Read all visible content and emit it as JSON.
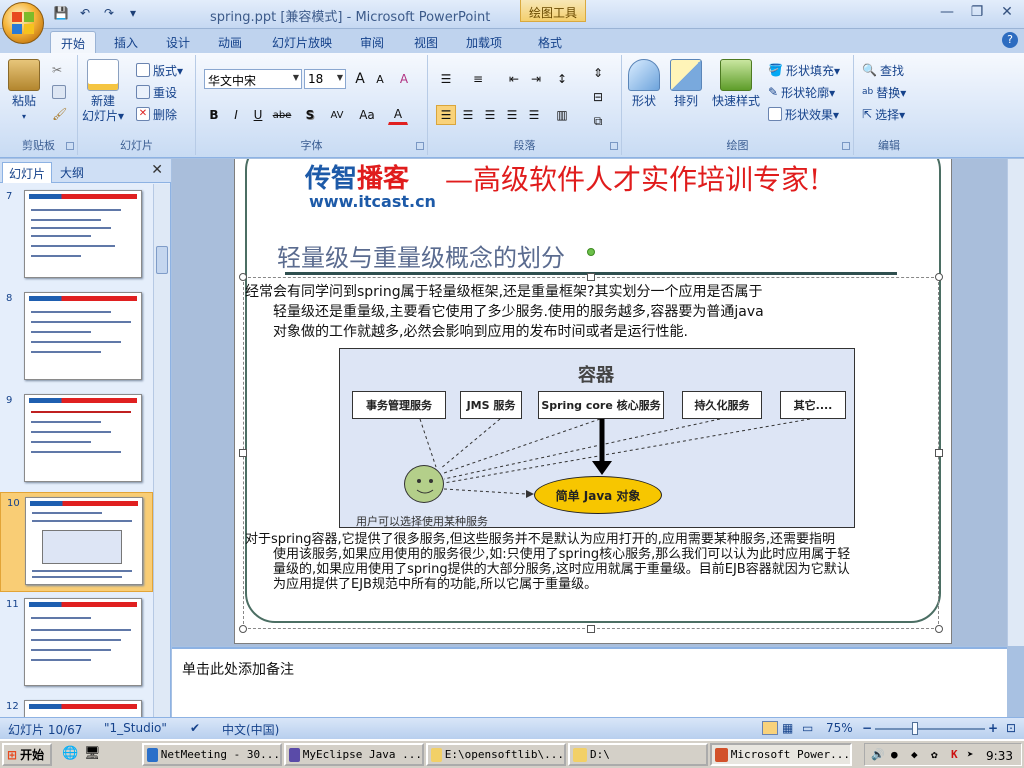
{
  "window": {
    "title": "spring.ppt [兼容模式] - Microsoft PowerPoint",
    "contextual_tab_group": "绘图工具"
  },
  "qat": {
    "save": "💾",
    "undo": "↶",
    "redo": "↷",
    "more": "▾"
  },
  "window_controls": {
    "minimize": "—",
    "restore": "❐",
    "close": "✕"
  },
  "tabs": [
    "开始",
    "插入",
    "设计",
    "动画",
    "幻灯片放映",
    "审阅",
    "视图",
    "加载项",
    "格式"
  ],
  "active_tab": "开始",
  "help": "?",
  "ribbon": {
    "clipboard": {
      "label": "剪贴板",
      "paste": "粘贴"
    },
    "slides": {
      "label": "幻灯片",
      "new_slide_1": "新建",
      "new_slide_2": "幻灯片▾",
      "layout": "版式▾",
      "reset": "重设",
      "delete": "删除"
    },
    "font": {
      "label": "字体",
      "font_name": "华文中宋",
      "font_size": "18",
      "grow": "A",
      "shrink": "A",
      "clear": "A",
      "bold": "B",
      "italic": "I",
      "underline": "U",
      "strike": "abe",
      "shadow": "S",
      "spacing": "AV",
      "case": "Aa",
      "color": "A"
    },
    "paragraph": {
      "label": "段落"
    },
    "drawing": {
      "label": "绘图",
      "shapes": "形状",
      "arrange": "排列",
      "quick_styles": "快速样式",
      "fill": "形状填充▾",
      "outline": "形状轮廓▾",
      "effects": "形状效果▾"
    },
    "editing": {
      "label": "编辑",
      "find": "查找",
      "replace": "替换▾",
      "select": "选择▾"
    }
  },
  "panel": {
    "tabs": [
      "幻灯片",
      "大纲"
    ],
    "close": "✕",
    "thumbnails": [
      {
        "num": "7",
        "selected": false
      },
      {
        "num": "8",
        "selected": false
      },
      {
        "num": "9",
        "selected": false
      },
      {
        "num": "10",
        "selected": true
      },
      {
        "num": "11",
        "selected": false
      },
      {
        "num": "12",
        "selected": false
      }
    ]
  },
  "slide": {
    "logo_cn_a": "传智",
    "logo_cn_b": "播客",
    "logo_url": "www.itcast.cn",
    "slogan": "—高级软件人才实作培训专家!",
    "title": "轻量级与重量级概念的划分",
    "para1": [
      "经常会有同学问到spring属于轻量级框架,还是重量框架?其实划分一个应用是否属于",
      "轻量级还是重量级,主要看它使用了多少服务.使用的服务越多,容器要为普通java",
      "对象做的工作就越多,必然会影响到应用的发布时间或者是运行性能."
    ],
    "diagram": {
      "title": "容器",
      "services": [
        "事务管理服务",
        "JMS 服务",
        "Spring core 核心服务",
        "持久化服务",
        "其它...."
      ],
      "core_object": "简单 Java 对象",
      "user_caption": "用户可以选择使用某种服务"
    },
    "para2": [
      "对于spring容器,它提供了很多服务,但这些服务并不是默认为应用打开的,应用需要某种服务,还需要指明",
      "使用该服务,如果应用使用的服务很少,如:只使用了spring核心服务,那么我们可以认为此时应用属于轻",
      "量级的,如果应用使用了spring提供的大部分服务,这时应用就属于重量级。目前EJB容器就因为它默认",
      "为应用提供了EJB规范中所有的功能,所以它属于重量级。"
    ]
  },
  "notes": {
    "placeholder": "单击此处添加备注"
  },
  "status": {
    "slide_counter": "幻灯片 10/67",
    "theme": "\"1_Studio\"",
    "language": "中文(中国)",
    "zoom": "75%",
    "zoom_minus": "−",
    "zoom_plus": "+"
  },
  "taskbar": {
    "start": "开始",
    "tasks": [
      "NetMeeting - 30...",
      "MyEclipse Java ...",
      "E:\\opensoftlib\\...",
      "D:\\",
      "Microsoft Power..."
    ],
    "active_task_index": 4,
    "clock": "9:33"
  }
}
